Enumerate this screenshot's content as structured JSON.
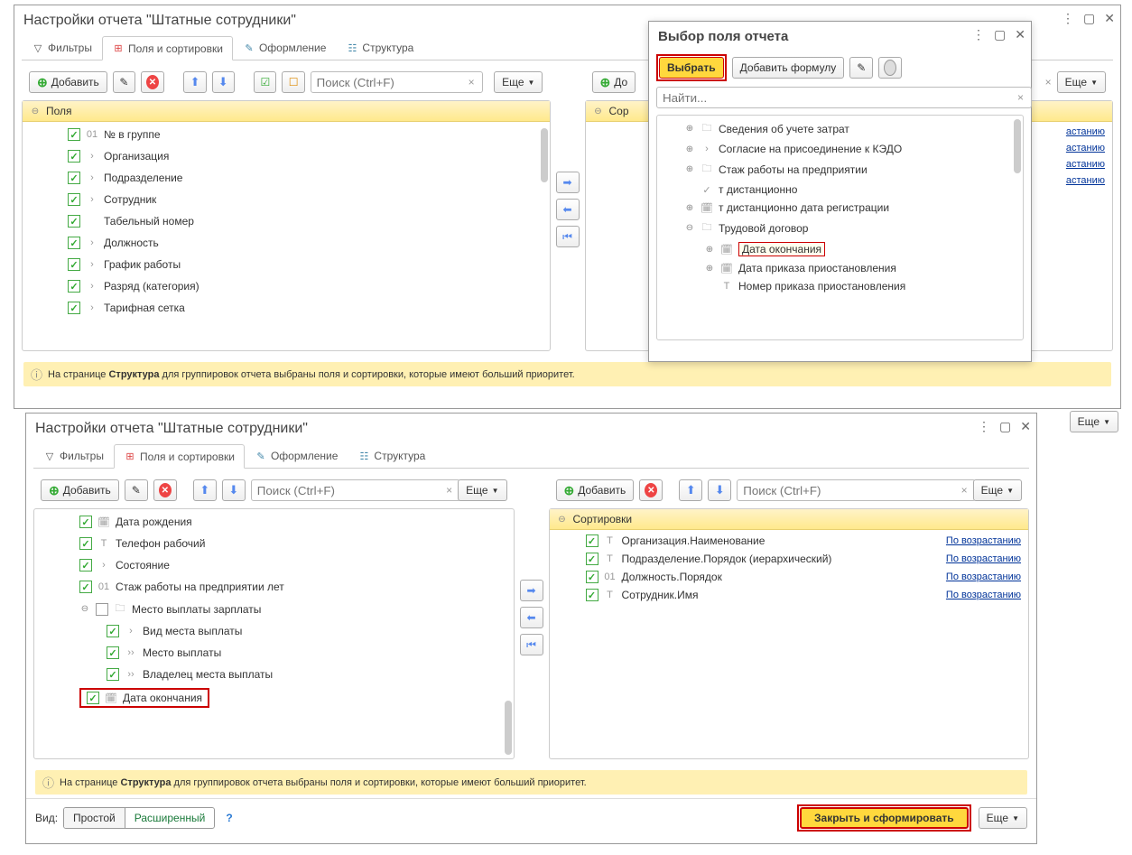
{
  "window1": {
    "title": "Настройки отчета \"Штатные сотрудники\"",
    "tabs": {
      "filters": "Фильтры",
      "fields": "Поля и сортировки",
      "format": "Оформление",
      "structure": "Структура"
    },
    "toolbar": {
      "add": "Добавить",
      "more": "Еще",
      "search_ph": "Поиск (Ctrl+F)"
    },
    "fields_header": "Поля",
    "fields": [
      {
        "icon": "01",
        "label": "№ в группе"
      },
      {
        "icon": "›",
        "label": "Организация"
      },
      {
        "icon": "›",
        "label": "Подразделение"
      },
      {
        "icon": "›",
        "label": "Сотрудник"
      },
      {
        "icon": "",
        "label": "Табельный номер"
      },
      {
        "icon": "›",
        "label": "Должность"
      },
      {
        "icon": "›",
        "label": "График работы"
      },
      {
        "icon": "›",
        "label": "Разряд (категория)"
      },
      {
        "icon": "›",
        "label": "Тарифная сетка"
      }
    ],
    "hint_pre": "На странице ",
    "hint_b": "Структура",
    "hint_post": " для группировок отчета выбраны поля и сортировки, которые имеют больший приоритет.",
    "sort_hint1": "астанию",
    "sort_hint2": "астанию",
    "sort_hint3": "астанию",
    "sort_hint4": "астанию"
  },
  "popup": {
    "title": "Выбор поля отчета",
    "select": "Выбрать",
    "formula": "Добавить формулу",
    "find_ph": "Найти...",
    "items": [
      {
        "exp": "⊕",
        "ico": "🗀",
        "label": "Сведения об учете затрат"
      },
      {
        "exp": "⊕",
        "ico": "›",
        "label": "Согласие на присоединение к КЭДО"
      },
      {
        "exp": "⊕",
        "ico": "🗀",
        "label": "Стаж работы на предприятии"
      },
      {
        "exp": "",
        "ico": "✓",
        "label": "т дистанционно"
      },
      {
        "exp": "⊕",
        "ico": "🗓",
        "label": "т дистанционно дата регистрации"
      },
      {
        "exp": "⊖",
        "ico": "🗀",
        "label": "Трудовой договор"
      },
      {
        "exp": "⊕",
        "ico": "🗓",
        "label": "Дата окончания",
        "child": true,
        "sel": true
      },
      {
        "exp": "⊕",
        "ico": "🗓",
        "label": "Дата приказа приостановления",
        "child": true
      },
      {
        "exp": "",
        "ico": "T",
        "label": "Номер приказа приостановления",
        "child": true
      }
    ]
  },
  "window2": {
    "title": "Настройки отчета \"Штатные сотрудники\"",
    "tabs": {
      "filters": "Фильтры",
      "fields": "Поля и сортировки",
      "format": "Оформление",
      "structure": "Структура"
    },
    "toolbar": {
      "add": "Добавить",
      "more": "Еще",
      "search_ph": "Поиск (Ctrl+F)"
    },
    "fields": [
      {
        "icon": "🗓",
        "label": "Дата рождения"
      },
      {
        "icon": "T",
        "label": "Телефон рабочий"
      },
      {
        "icon": "›",
        "label": "Состояние"
      },
      {
        "icon": "01",
        "label": "Стаж работы на предприятии лет"
      },
      {
        "icon": "🗀",
        "label": "Место выплаты зарплаты",
        "unchecked": true,
        "exp": "⊖"
      },
      {
        "icon": "›",
        "label": "Вид места выплаты",
        "child": true
      },
      {
        "icon": "››",
        "label": "Место выплаты",
        "child": true
      },
      {
        "icon": "››",
        "label": "Владелец места выплаты",
        "child": true
      },
      {
        "icon": "🗓",
        "label": "Дата окончания",
        "boxed": true
      }
    ],
    "sort_header": "Сортировки",
    "sorts": [
      {
        "ico": "T",
        "label": "Организация.Наименование",
        "dir": "По возрастанию"
      },
      {
        "ico": "T",
        "label": "Подразделение.Порядок (иерархический)",
        "dir": "По возрастанию"
      },
      {
        "ico": "01",
        "label": "Должность.Порядок",
        "dir": "По возрастанию"
      },
      {
        "ico": "T",
        "label": "Сотрудник.Имя",
        "dir": "По возрастанию"
      }
    ],
    "hint_pre": "На странице ",
    "hint_b": "Структура",
    "hint_post": " для группировок отчета выбраны поля и сортировки, которые имеют больший приоритет.",
    "view_label": "Вид:",
    "simple": "Простой",
    "advanced": "Расширенный",
    "close_gen": "Закрыть и сформировать",
    "more": "Еще",
    "sort_add": "До"
  },
  "outer_more": "Еще"
}
